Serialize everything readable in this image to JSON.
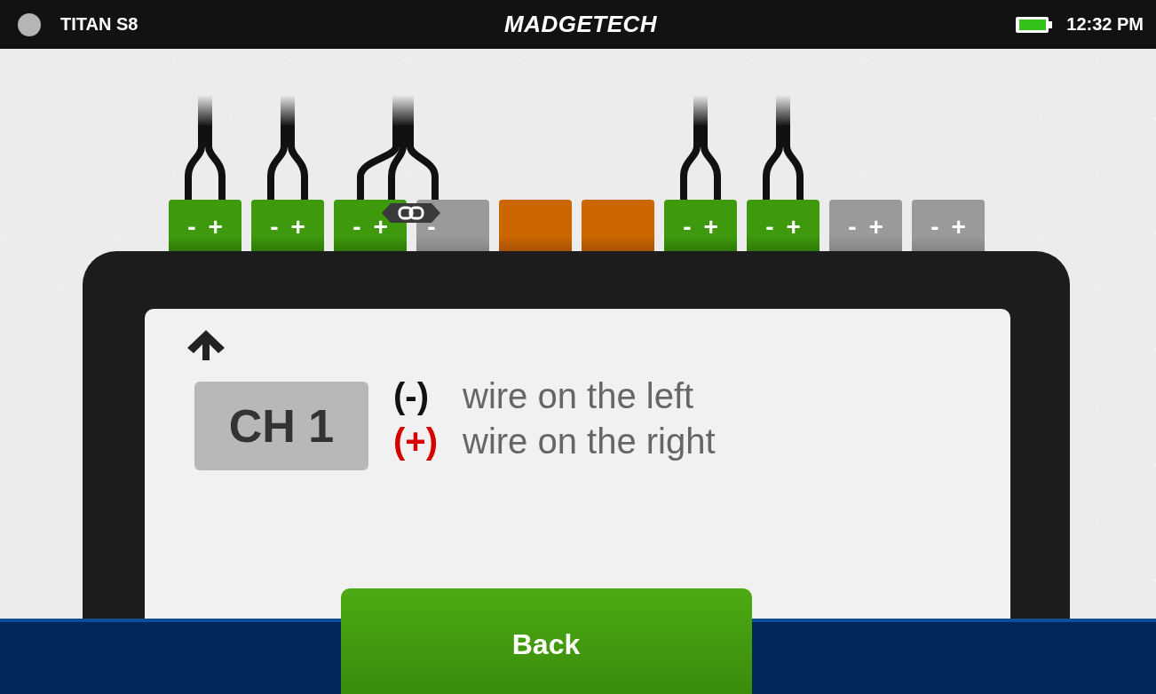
{
  "status_bar": {
    "device": "TITAN S8",
    "logo": "MADGETECH",
    "time": "12:32 PM"
  },
  "terminals": [
    {
      "kind": "active",
      "wired": true,
      "linked": false,
      "minus": "-",
      "plus": "+"
    },
    {
      "kind": "active",
      "wired": true,
      "linked": false,
      "minus": "-",
      "plus": "+"
    },
    {
      "kind": "active",
      "wired": true,
      "linked": true,
      "minus": "-",
      "plus": "+"
    },
    {
      "kind": "inactive",
      "wired": false,
      "linked": false,
      "minus": "-"
    },
    {
      "kind": "disabled",
      "wired": false,
      "linked": false
    },
    {
      "kind": "disabled",
      "wired": false,
      "linked": false
    },
    {
      "kind": "active",
      "wired": true,
      "linked": false,
      "minus": "-",
      "plus": "+"
    },
    {
      "kind": "active",
      "wired": true,
      "linked": false,
      "minus": "-",
      "plus": "+"
    },
    {
      "kind": "inactive",
      "wired": false,
      "linked": false,
      "minus": "-",
      "plus": "+"
    },
    {
      "kind": "inactive",
      "wired": false,
      "linked": false,
      "minus": "-",
      "plus": "+"
    }
  ],
  "channel": {
    "label": "CH 1"
  },
  "instructions": [
    {
      "kind": "negative",
      "sign": "(-)",
      "text": "wire on the left"
    },
    {
      "kind": "positive",
      "sign": "(+)",
      "text": "wire on the right"
    }
  ],
  "back_button": "Back"
}
